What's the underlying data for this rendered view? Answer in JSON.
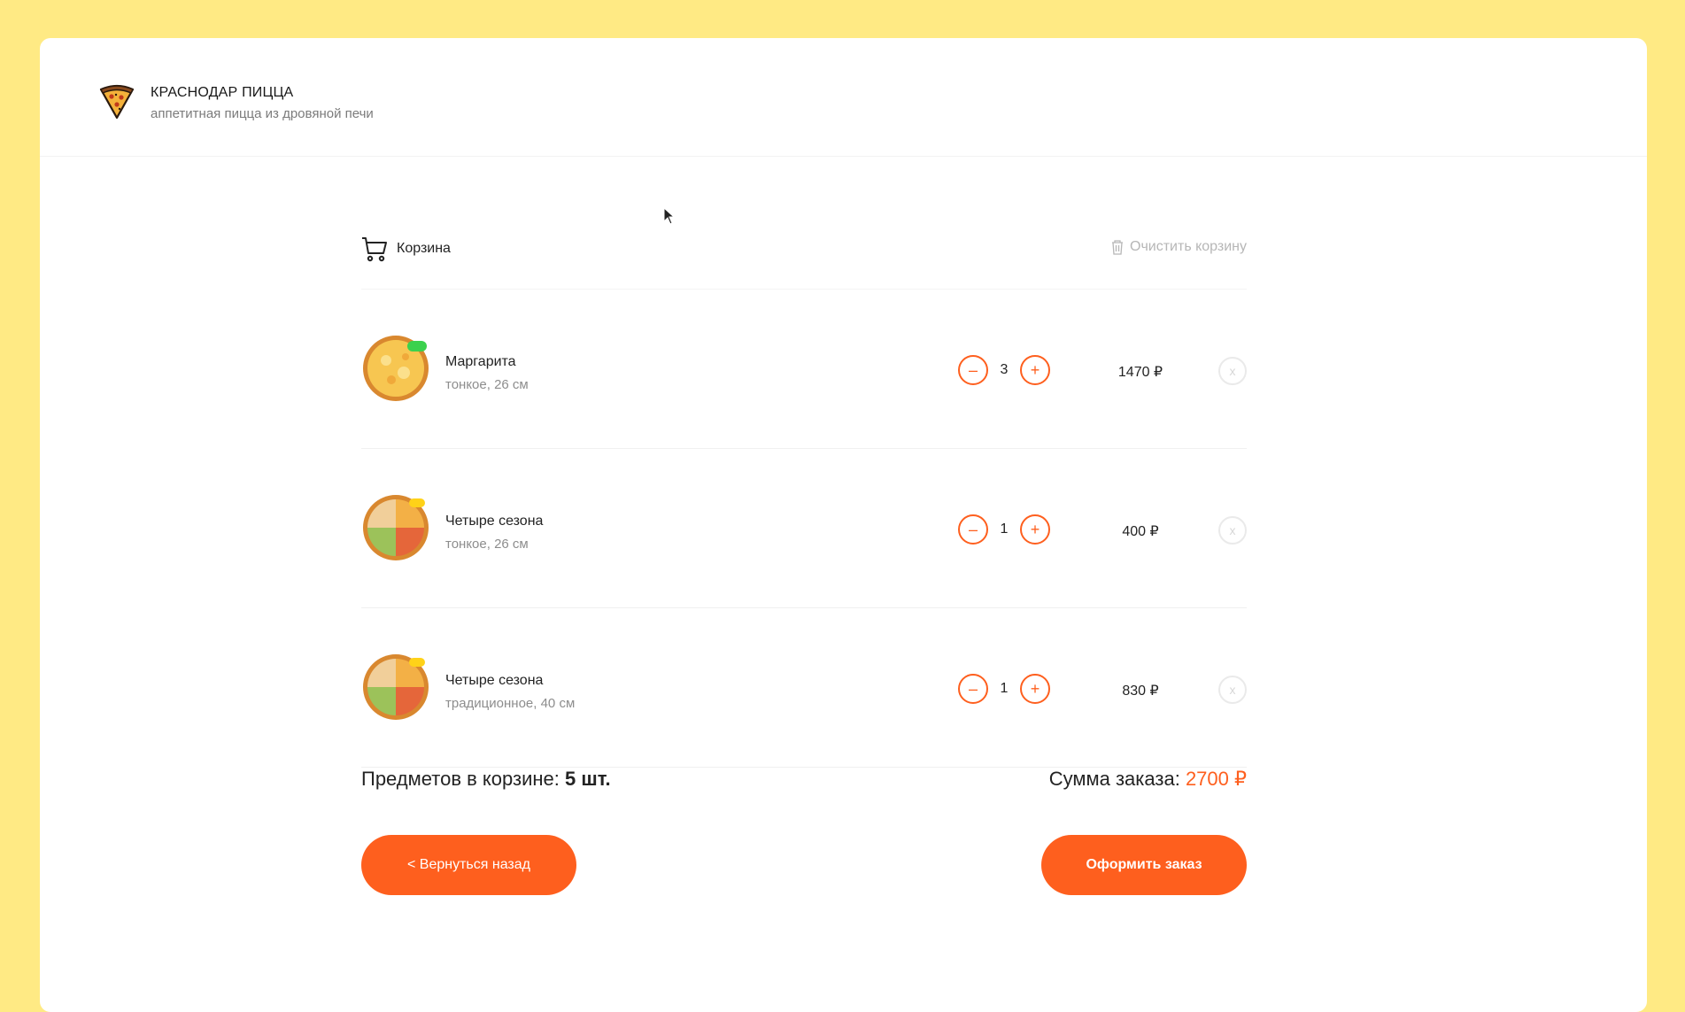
{
  "colors": {
    "background": "#ffea84",
    "accent": "#fe5f1e",
    "muted": "#b6b6b6"
  },
  "header": {
    "title": "КРАСНОДАР ПИЦЦА",
    "subtitle": "аппетитная пицца из дровяной печи",
    "logo_icon": "pizza-slice-icon"
  },
  "cart": {
    "title": "Корзина",
    "clear_label": "Очистить корзину",
    "items": [
      {
        "name": "Маргарита",
        "desc": "тонкое, 26 см",
        "qty": "3",
        "price": "1470 ₽",
        "badge": "green",
        "minus": "–",
        "plus": "+",
        "remove": "x"
      },
      {
        "name": "Четыре сезона",
        "desc": "тонкое, 26 см",
        "qty": "1",
        "price": "400 ₽",
        "badge": "yellow",
        "minus": "–",
        "plus": "+",
        "remove": "x"
      },
      {
        "name": "Четыре сезона",
        "desc": "традиционное, 40 см",
        "qty": "1",
        "price": "830 ₽",
        "badge": "yellow",
        "minus": "–",
        "plus": "+",
        "remove": "x"
      }
    ],
    "count_label": "Предметов в корзине:",
    "count_value": "5 шт.",
    "total_label": "Сумма заказа:",
    "total_value": "2700 ₽",
    "back_label": "< Вернуться назад",
    "order_label": "Оформить заказ"
  }
}
